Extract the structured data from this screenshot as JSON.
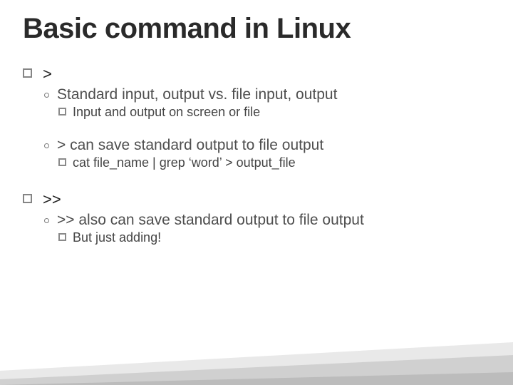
{
  "title": "Basic command in Linux",
  "items": {
    "a": ">",
    "a1": "Standard input, output vs. file input, output",
    "a1a": "Input and output on screen or file",
    "a2": "> can save standard output to file output",
    "a2a": "cat file_name | grep ‘word’ > output_file",
    "b": ">>",
    "b1": ">> also can save standard output to file output",
    "b1a": "But just adding!"
  }
}
